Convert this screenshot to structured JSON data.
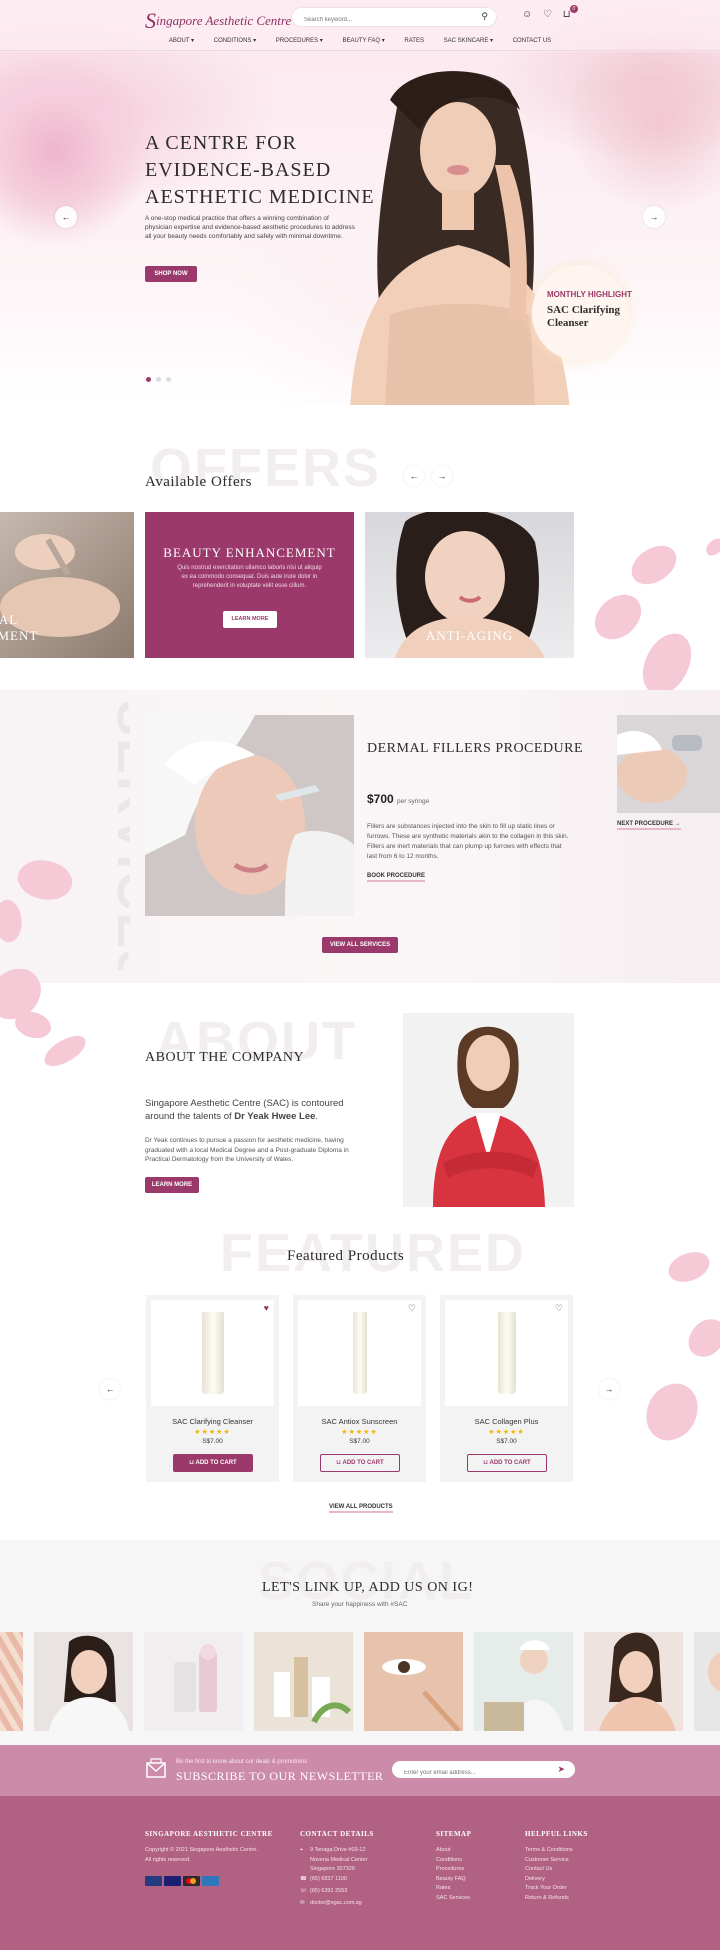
{
  "brand": {
    "logo_prefix": "S",
    "logo_text": "ingapore Aesthetic Centre",
    "accent": "#9b3a6a"
  },
  "header": {
    "search_placeholder": "Search keyword...",
    "cart_count": "0",
    "nav": [
      "About",
      "Conditions",
      "Procedures",
      "Beauty FAQ",
      "Rates",
      "SAC Skincare",
      "Contact Us"
    ]
  },
  "hero": {
    "title_1": "A centre for",
    "title_2": "evidence-based",
    "title_3": "aesthetic medicine",
    "text": "A one-stop medical practice that offers a winning combination of physician expertise and evidence-based aesthetic procedures to address all your beauty needs comfortably and safely with minimal downtime.",
    "cta": "Shop Now",
    "highlight_label": "MONTHLY HIGHLIGHT",
    "highlight_product_1": "SAC Clarifying",
    "highlight_product_2": "Cleanser",
    "slide_current": 1,
    "slide_total": 3
  },
  "offers": {
    "ghost": "OFFERS",
    "title": "Available Offers",
    "card_left": "Medical Treatment",
    "feature_title": "Beauty Enhancement",
    "feature_text": "Quis nostrud exercitation ullamco laboris nisi ut aliquip ex ea commodo consequat. Duis aute irure dolor in reprehenderit in voluptate velit esse cillum.",
    "feature_cta": "Learn More",
    "card_right": "Anti-Aging"
  },
  "services": {
    "ghost": "SERVICES",
    "title": "Dermal Fillers Procedure",
    "price": "$700",
    "price_unit": "per syringe",
    "text": "Fillers are substances injected into the skin to fill up static lines or furrows. These are synthetic materials akin to the collagen in this skin. Fillers are inert materials that can plump up furrows with effects that last from 6 to 12 months.",
    "book": "Book Procedure",
    "next": "Next Procedure",
    "view_all": "View All Services"
  },
  "about": {
    "ghost": "ABOUT",
    "title": "About the Company",
    "lead_1": "Singapore Aesthetic Centre (SAC) is contoured",
    "lead_2": "around the talents of ",
    "lead_name": "Dr Yeak Hwee Lee",
    "text": "Dr Yeak continues to pursue a passion for aesthetic medicine, having graduated with a local Medical Degree and a Post-graduate Diploma in Practical Dermatology from the University of Wales.",
    "cta": "Learn More"
  },
  "featured": {
    "ghost": "FEATURED",
    "title": "Featured Products",
    "products": [
      {
        "name": "SAC Clarifying Cleanser",
        "stars": "★★★★★",
        "price": "S$7.00",
        "cta": "Add to Cart"
      },
      {
        "name": "SAC Antiox Sunscreen",
        "stars": "★★★★★",
        "price": "S$7.00",
        "cta": "Add to Cart"
      },
      {
        "name": "SAC Collagen Plus",
        "stars": "★★★★★",
        "price": "S$7.00",
        "cta": "Add to Cart"
      }
    ],
    "view_all": "View All Products"
  },
  "social": {
    "ghost": "SOCIAL",
    "title": "Let's link up, add us on IG!",
    "subtitle": "Share your happiness with #SAC"
  },
  "newsletter": {
    "small": "Be the first to know about our deals & promotions",
    "title": "Subscribe to our newsletter",
    "placeholder": "Enter your email address..."
  },
  "footer": {
    "col1_title": "Singapore Aesthetic Centre",
    "copyright": "Copyright © 2021 Singapore Aesthetic Centre.",
    "rights": "All rights reserved.",
    "payments": [
      "PayPal",
      "VISA",
      "Mastercard",
      "Amex"
    ],
    "col2_title": "Contact Details",
    "address_1": "9 Tenaga Drive #03-12",
    "address_2": "Novena Medical Center",
    "address_3": "Singapore 307326",
    "phone": "(65) 6837 1100",
    "fax": "(65) 6391 2553",
    "email": "doctor@sgac.com.sg",
    "col3_title": "Sitemap",
    "sitemap": [
      "About",
      "Conditions",
      "Procedures",
      "Beauty FAQ",
      "Rates",
      "SAC Services"
    ],
    "col4_title": "Helpful Links",
    "helpful": [
      "Terms & Conditions",
      "Customer Service",
      "Contact Us",
      "Delivery",
      "Track Your Order",
      "Return & Refunds"
    ]
  }
}
